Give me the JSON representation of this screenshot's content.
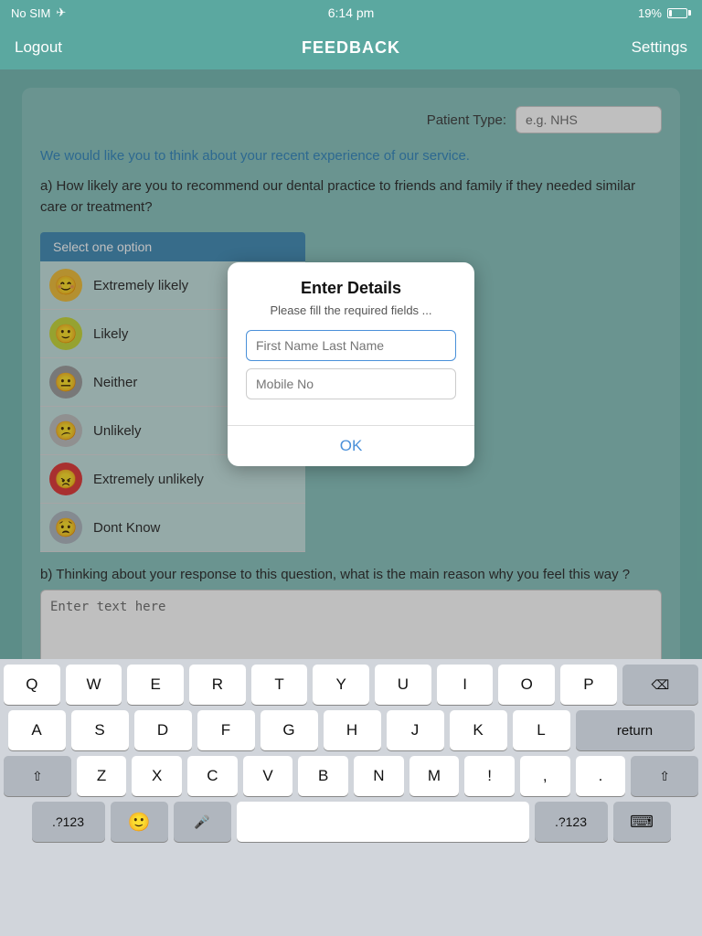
{
  "statusBar": {
    "carrier": "No SIM",
    "time": "6:14 pm",
    "battery": "19%",
    "wifi": "off"
  },
  "navBar": {
    "title": "FEEDBACK",
    "leftLabel": "Logout",
    "rightLabel": "Settings"
  },
  "patientType": {
    "label": "Patient Type:",
    "placeholder": "e.g. NHS"
  },
  "serviceText": "We would like you to think about your recent experience of our service.",
  "questionA": "a) How likely are you to recommend our dental practice to friends and family if they needed similar care or treatment?",
  "selectLabel": "Select one option",
  "options": [
    {
      "emoji": "😊",
      "label": "Extremely likely",
      "color": "#f0c040"
    },
    {
      "emoji": "🙂",
      "label": "Likely",
      "color": "#c8d840"
    },
    {
      "emoji": "😐",
      "label": "Neither",
      "color": "#a0a0a0"
    },
    {
      "emoji": "😕",
      "label": "Unlikely",
      "color": "#c0c0c0"
    },
    {
      "emoji": "😠",
      "label": "Extremely unlikely",
      "color": "#e04040"
    },
    {
      "emoji": "😟",
      "label": "Dont Know",
      "color": "#b0b8c0"
    }
  ],
  "questionB": "b) Thinking about your response to this question, what is the main reason why you feel this way ?",
  "textAreaPlaceholder": "Enter text here",
  "dialog": {
    "title": "Enter Details",
    "subtitle": "Please fill the required fields ...",
    "firstNamePlaceholder": "First Name Last Name",
    "mobilePlaceholder": "Mobile No",
    "okLabel": "OK"
  },
  "keyboard": {
    "rows": [
      [
        "Q",
        "W",
        "E",
        "R",
        "T",
        "Y",
        "U",
        "I",
        "O",
        "P"
      ],
      [
        "A",
        "S",
        "D",
        "F",
        "G",
        "H",
        "J",
        "K",
        "L"
      ],
      [
        "Z",
        "X",
        "C",
        "V",
        "B",
        "N",
        "M",
        "!",
        ",",
        "."
      ],
      []
    ],
    "deleteLabel": "⌫",
    "returnLabel": "return",
    "shiftLabel": "⇧",
    "numbersLabel": ".?123",
    "spaceLabel": "",
    "dotNumLabel": ".?123",
    "keyboardLabel": "⌨"
  }
}
